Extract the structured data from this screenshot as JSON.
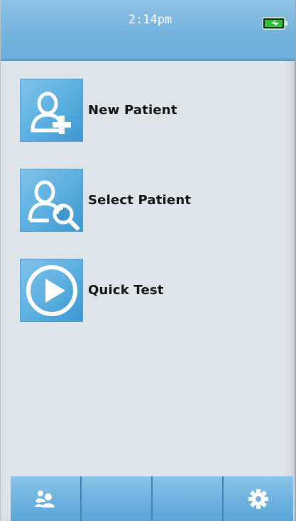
{
  "status_bar": {
    "time": "2:14pm",
    "battery_icon": "battery-charging-icon",
    "battery_color": "#2fbf3a"
  },
  "menu": {
    "items": [
      {
        "label": "New Patient",
        "icon": "add-patient-icon"
      },
      {
        "label": "Select Patient",
        "icon": "search-patient-icon"
      },
      {
        "label": "Quick Test",
        "icon": "play-icon"
      }
    ]
  },
  "bottom_bar": {
    "buttons": [
      {
        "icon": "patients-group-icon"
      },
      {
        "icon": ""
      },
      {
        "icon": ""
      },
      {
        "icon": "gear-icon"
      }
    ]
  },
  "colors": {
    "accent": "#6cb1de",
    "background": "#dfe4e8"
  }
}
